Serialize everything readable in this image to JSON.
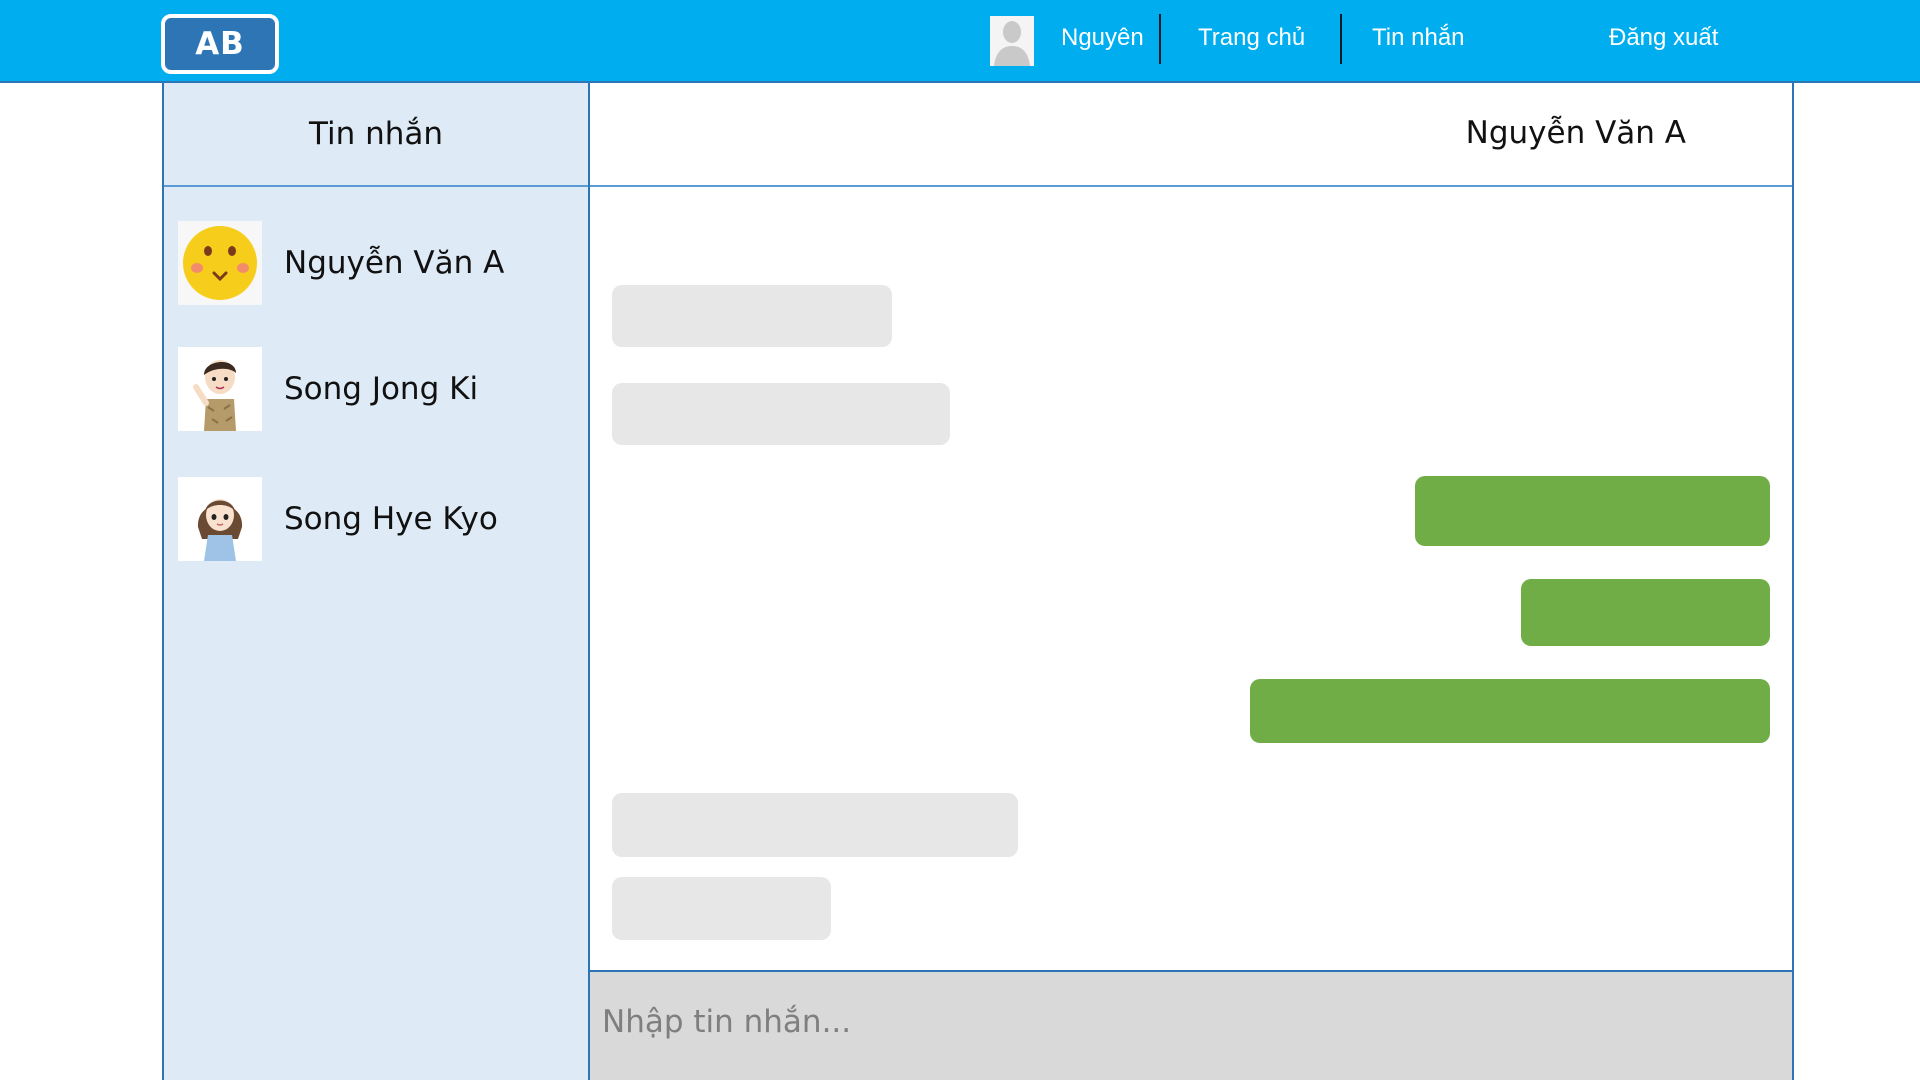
{
  "brand": {
    "logo_text": "AB"
  },
  "nav": {
    "user_name": "Nguyên",
    "home": "Trang chủ",
    "messages": "Tin nhắn",
    "logout": "Đăng xuất"
  },
  "sidebar": {
    "title": "Tin nhắn",
    "contacts": [
      {
        "name": "Nguyễn Văn A",
        "avatar": "smiley-emoji-icon"
      },
      {
        "name": "Song Jong Ki",
        "avatar": "cartoon-man-avatar"
      },
      {
        "name": "Song Hye Kyo",
        "avatar": "cartoon-woman-avatar"
      }
    ]
  },
  "chat": {
    "title": "Nguyễn Văn A",
    "messages": [
      {
        "direction": "incoming"
      },
      {
        "direction": "incoming"
      },
      {
        "direction": "outgoing"
      },
      {
        "direction": "outgoing"
      },
      {
        "direction": "outgoing"
      },
      {
        "direction": "incoming"
      },
      {
        "direction": "incoming"
      }
    ],
    "composer_placeholder": "Nhập tin nhắn..."
  },
  "colors": {
    "topbar": "#00AEEF",
    "logo": "#2E75B6",
    "sidebar": "#DEEAF6",
    "incoming_bubble": "#E7E7E7",
    "outgoing_bubble": "#70AD47",
    "composer": "#D9D9D9"
  }
}
